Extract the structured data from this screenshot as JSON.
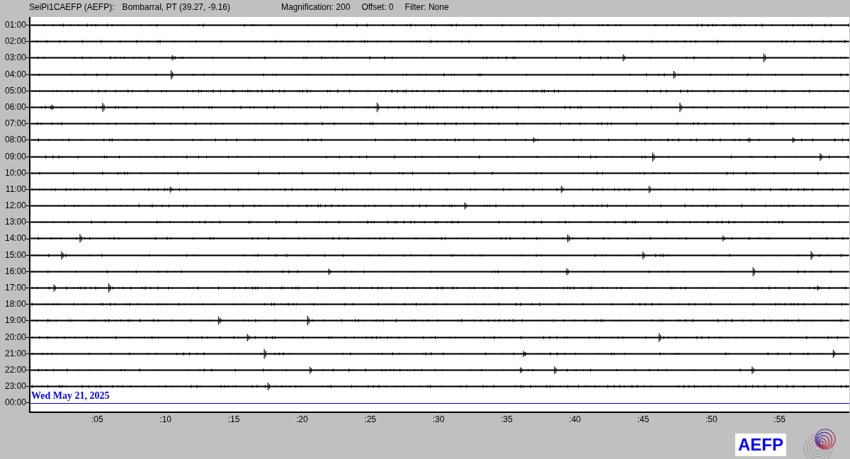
{
  "header": {
    "station": "SeiPi1CAEFP (AEFP):",
    "location": "Bombarral, PT (39.27, -9.16)",
    "magnification": "Magnification: 200",
    "offset": "Offset: 0",
    "filter": "Filter: None"
  },
  "rows": [
    {
      "label": "01:00",
      "kind": "trace"
    },
    {
      "label": "02:00",
      "kind": "trace"
    },
    {
      "label": "03:00",
      "kind": "trace"
    },
    {
      "label": "04:00",
      "kind": "trace"
    },
    {
      "label": "05:00",
      "kind": "trace"
    },
    {
      "label": "06:00",
      "kind": "trace"
    },
    {
      "label": "07:00",
      "kind": "trace"
    },
    {
      "label": "08:00",
      "kind": "trace"
    },
    {
      "label": "09:00",
      "kind": "trace"
    },
    {
      "label": "10:00",
      "kind": "trace"
    },
    {
      "label": "11:00",
      "kind": "trace"
    },
    {
      "label": "12:00",
      "kind": "trace"
    },
    {
      "label": "13:00",
      "kind": "trace"
    },
    {
      "label": "14:00",
      "kind": "trace"
    },
    {
      "label": "15:00",
      "kind": "trace"
    },
    {
      "label": "16:00",
      "kind": "trace"
    },
    {
      "label": "17:00",
      "kind": "trace"
    },
    {
      "label": "18:00",
      "kind": "trace"
    },
    {
      "label": "19:00",
      "kind": "trace"
    },
    {
      "label": "20:00",
      "kind": "trace"
    },
    {
      "label": "21:00",
      "kind": "trace"
    },
    {
      "label": "22:00",
      "kind": "trace"
    },
    {
      "label": "23:00",
      "kind": "trace"
    },
    {
      "label": "00:00",
      "kind": "current",
      "date": "Wed May 21, 2025"
    }
  ],
  "x_ticks": [
    ":05",
    ":10",
    ":15",
    ":20",
    ":25",
    ":30",
    ":35",
    ":40",
    ":45",
    ":50",
    ":55"
  ],
  "logo": {
    "text": "AEFP"
  }
}
